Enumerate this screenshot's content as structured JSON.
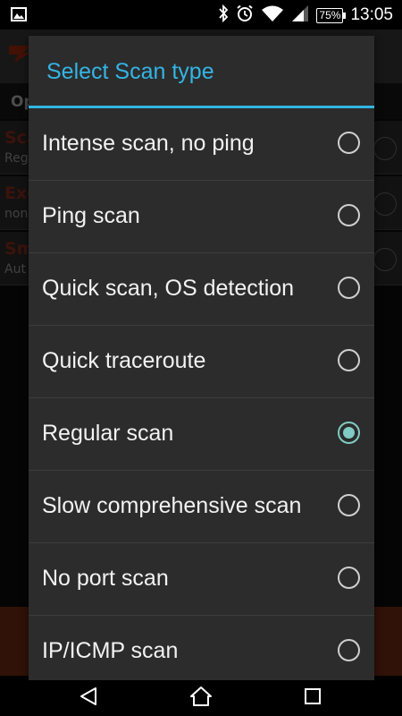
{
  "status_bar": {
    "battery": "75%",
    "time": "13:05"
  },
  "background_app": {
    "tab_partial": "Op",
    "rows": [
      {
        "title": "Sca",
        "subtitle": "Reg"
      },
      {
        "title": "Exe",
        "subtitle": "non"
      },
      {
        "title": "Sm",
        "subtitle": "Aut"
      }
    ]
  },
  "dialog": {
    "title": "Select Scan type",
    "options": [
      {
        "label": "Intense scan, no ping",
        "selected": false
      },
      {
        "label": "Ping scan",
        "selected": false
      },
      {
        "label": "Quick scan, OS detection",
        "selected": false
      },
      {
        "label": "Quick traceroute",
        "selected": false
      },
      {
        "label": "Regular scan",
        "selected": true
      },
      {
        "label": "Slow comprehensive scan",
        "selected": false
      },
      {
        "label": "No port scan",
        "selected": false
      },
      {
        "label": "IP/ICMP scan",
        "selected": false
      }
    ]
  },
  "colors": {
    "accent": "#33b5e5",
    "radio_checked": "#80cbc4",
    "dialog_bg": "#2c2c2c"
  },
  "icons": {
    "status_left": "image-notification-icon",
    "status_right": [
      "bluetooth-icon",
      "alarm-icon",
      "wifi-icon",
      "signal-icon",
      "battery-icon"
    ],
    "nav": [
      "back-icon",
      "home-icon",
      "recents-icon"
    ]
  }
}
